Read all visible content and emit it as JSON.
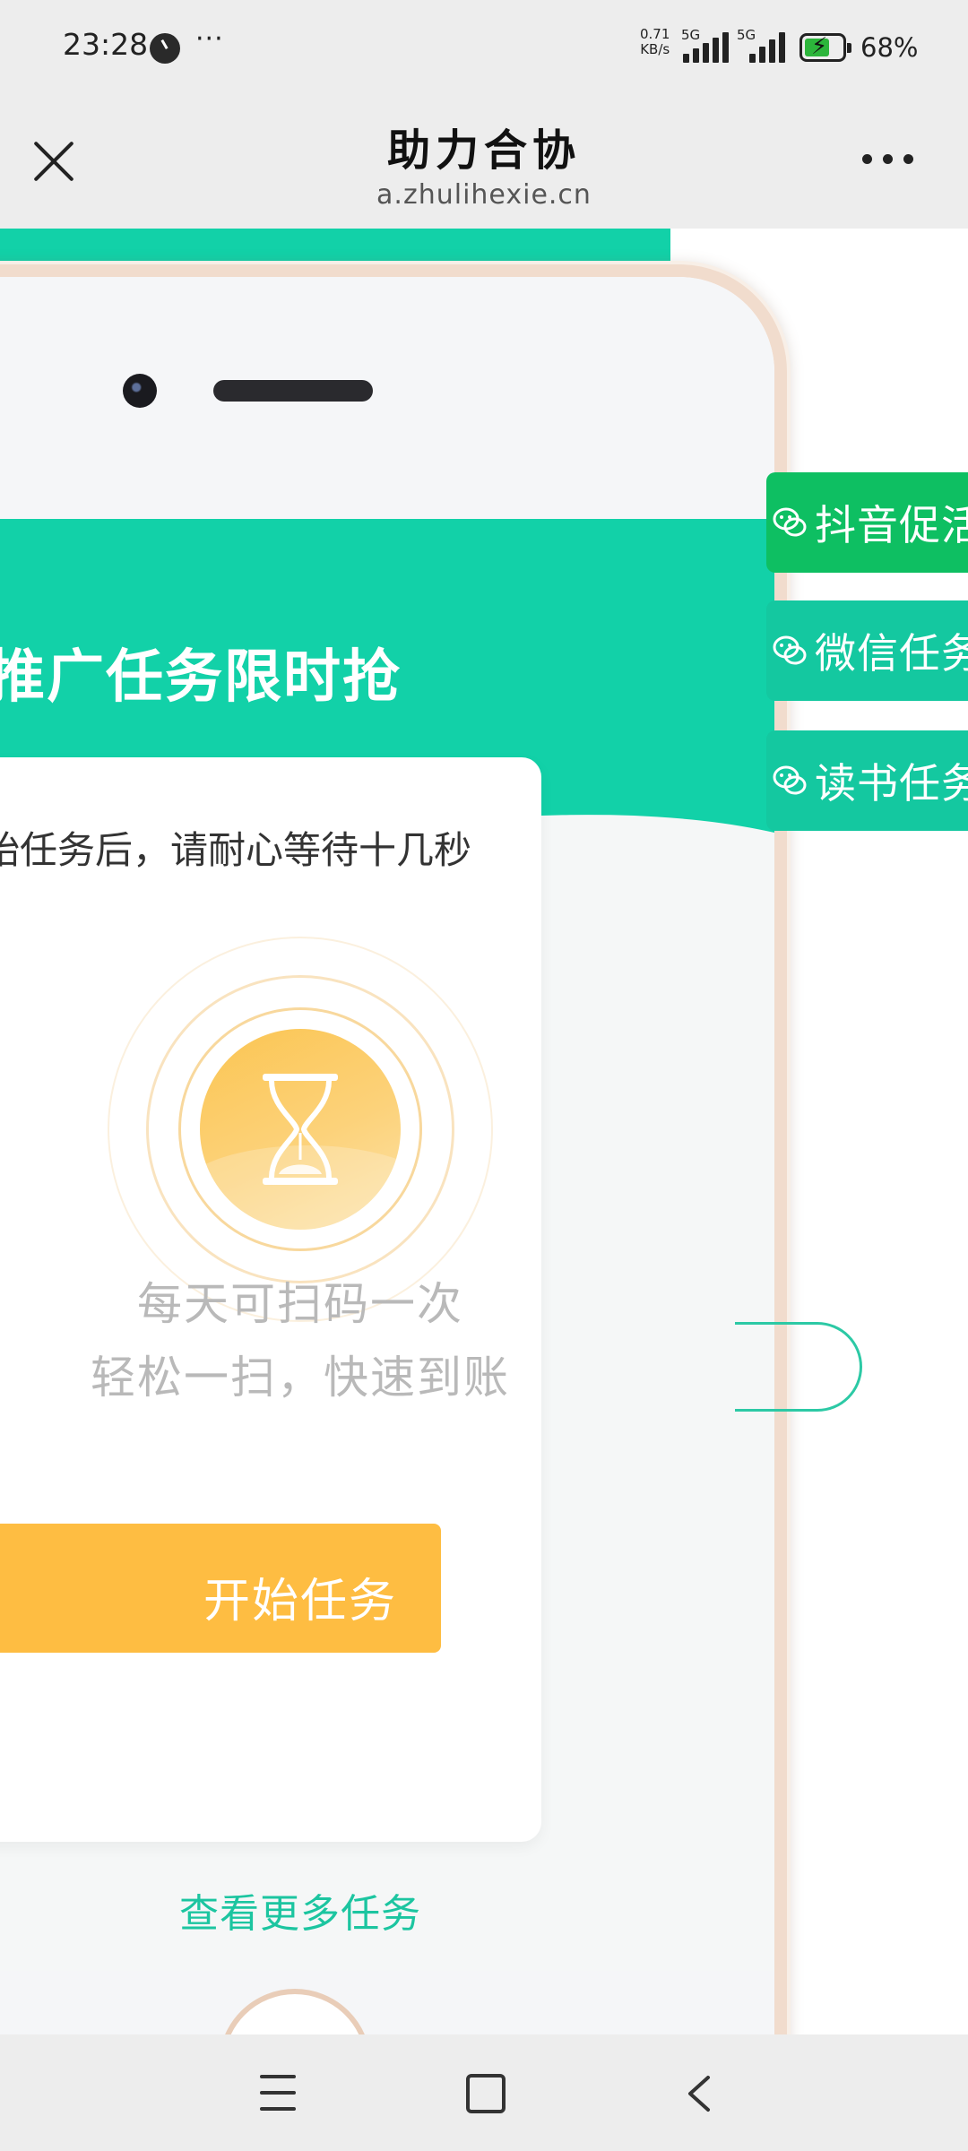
{
  "status_bar": {
    "time": "23:28",
    "dots": "···",
    "net_rate_value": "0.71",
    "net_rate_unit": "KB/s",
    "sim1_label": "5G",
    "sim2_label": "5G",
    "battery_percent": "68%",
    "battery_level": 0.68,
    "battery_color": "#2cb53b"
  },
  "header": {
    "title": "助力合协",
    "url": "a.zhulihexie.cn"
  },
  "task_panel": {
    "banner_title": "号号推广任务限时抢",
    "note": "点击开始任务后，请耐心等待十几秒",
    "line1": "每天可扫码一次",
    "line2": "轻松一扫，快速到账",
    "start_button": "开始任务",
    "more_link": "查看更多任务"
  },
  "side_tabs": [
    {
      "label": "抖音促活",
      "icon": "wechat-icon",
      "color": "#0ebf62"
    },
    {
      "label": "微信任务",
      "icon": "wechat-icon",
      "color": "#14c8a0"
    },
    {
      "label": "读书任务",
      "icon": "wechat-icon",
      "color": "#14c8a0"
    }
  ],
  "colors": {
    "brand_teal": "#12d1a8",
    "button_yellow": "#febd42",
    "link_teal": "#1cc5a0"
  },
  "nav_bar": {
    "icons": [
      "menu-icon",
      "home-icon",
      "back-icon"
    ]
  }
}
